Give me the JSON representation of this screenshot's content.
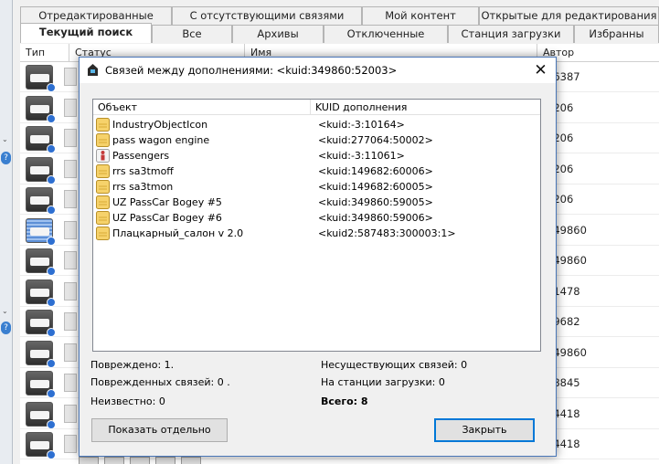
{
  "tabs_top": [
    "Отредактированные",
    "С отсутствующими связями",
    "Мой контент",
    "Открытые для редактирования"
  ],
  "tabs_bottom": [
    "Текущий поиск",
    "Все",
    "Архивы",
    "Отключенные",
    "Станция загрузки",
    "Избранны"
  ],
  "grid": {
    "columns": [
      "Тип",
      "Статус",
      "Имя",
      "Автор"
    ],
    "authors": [
      "16387",
      "2206",
      "2206",
      "2206",
      "2206",
      "349860",
      "349860",
      "21478",
      "49682",
      "349860",
      "78845",
      "64418",
      "64418"
    ]
  },
  "dialog": {
    "title": "Связей между дополнениями: <kuid:349860:52003>",
    "close_glyph": "✕",
    "columns": {
      "object": "Объект",
      "kuid": "KUID дополнения"
    },
    "rows": [
      {
        "name": "IndustryObjectIcon",
        "kuid": "<kuid:-3:10164>",
        "icon": "folder-icon"
      },
      {
        "name": "pass wagon engine",
        "kuid": "<kuid:277064:50002>",
        "icon": "folder-icon"
      },
      {
        "name": "Passengers",
        "kuid": "<kuid:-3:11061>",
        "icon": "passenger-icon"
      },
      {
        "name": "rrs sa3tmoff",
        "kuid": "<kuid:149682:60006>",
        "icon": "folder-icon"
      },
      {
        "name": "rrs sa3tmon",
        "kuid": "<kuid:149682:60005>",
        "icon": "folder-icon"
      },
      {
        "name": "UZ PassCar Bogey #5",
        "kuid": "<kuid:349860:59005>",
        "icon": "folder-icon"
      },
      {
        "name": "UZ PassCar Bogey #6",
        "kuid": "<kuid:349860:59006>",
        "icon": "folder-icon"
      },
      {
        "name": "Плацкарный_салон v 2.0",
        "kuid": "<kuid2:587483:300003:1>",
        "icon": "folder-icon"
      }
    ],
    "summary": {
      "damaged": "Повреждено: 1.",
      "damaged_links": "Поврежденных связей: 0 .",
      "unknown": "Неизвестно: 0",
      "missing_links": "Несуществующих связей: 0",
      "on_station": "На станции загрузки: 0",
      "total": "Всего: 8"
    },
    "buttons": {
      "show_separately": "Показать отдельно",
      "close": "Закрыть"
    }
  }
}
